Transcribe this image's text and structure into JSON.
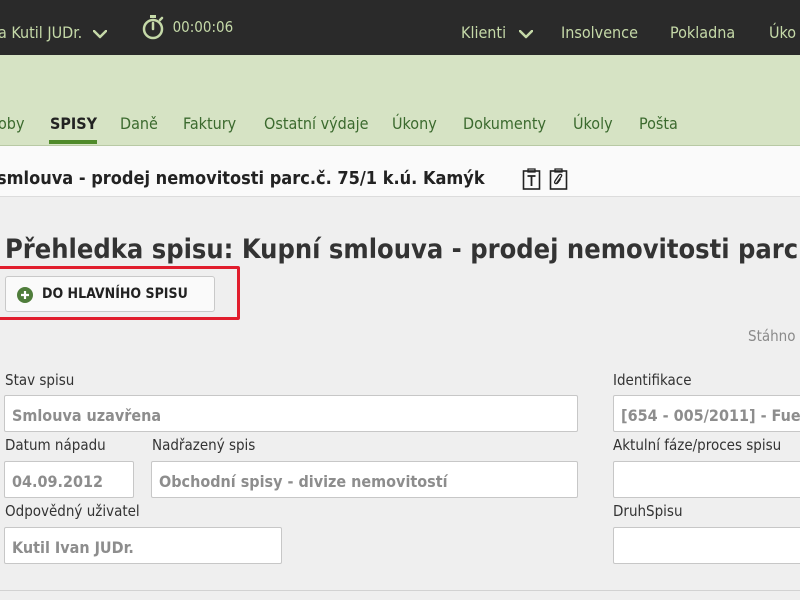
{
  "topbar": {
    "user_name": "a Kutil JUDr.",
    "timer": "00:00:06",
    "nav": {
      "klienti": "Klienti",
      "insolvence": "Insolvence",
      "pokladna": "Pokladna",
      "ukony": "Úko"
    }
  },
  "tabs": [
    "oby",
    "SPISY",
    "Daně",
    "Faktury",
    "Ostatní výdaje",
    "Úkony",
    "Dokumenty",
    "Úkoly",
    "Pošta"
  ],
  "document": {
    "title": "smlouva - prodej nemovitosti parc.č. 75/1 k.ú. Kamýk",
    "overview_title": "Přehledka spisu: Kupní smlouva - prodej nemovitosti parc.č."
  },
  "actions": {
    "main_file_button": "DO HLAVNÍHO SPISU",
    "download": "Stáhno"
  },
  "form": {
    "status_label": "Stav spisu",
    "status_value": "Smlouva uzavřena",
    "identification_label": "Identifikace",
    "identification_value": "[654 - 005/2011] - Fue",
    "idea_date_label": "Datum nápadu",
    "idea_date_value": "04.09.2012",
    "parent_label": "Nadřazený spis",
    "parent_value": "Obchodní spisy - divize nemovitostí",
    "phase_label": "Aktulní fáze/proces spisu",
    "phase_value": "",
    "responsible_label": "Odpovědný uživatel",
    "responsible_value": "Kutil Ivan  JUDr.",
    "type_label": "DruhSpisu",
    "type_value": ""
  },
  "colors": {
    "topbar_bg": "#2a2a2a",
    "topbar_text": "#c5d9a8",
    "band_bg": "#d6e3c4",
    "tab_text": "#3b6a2e",
    "tab_active_underline": "#4f8a2a",
    "highlight": "#e11d2d",
    "plus_icon": "#4f7d3b"
  }
}
